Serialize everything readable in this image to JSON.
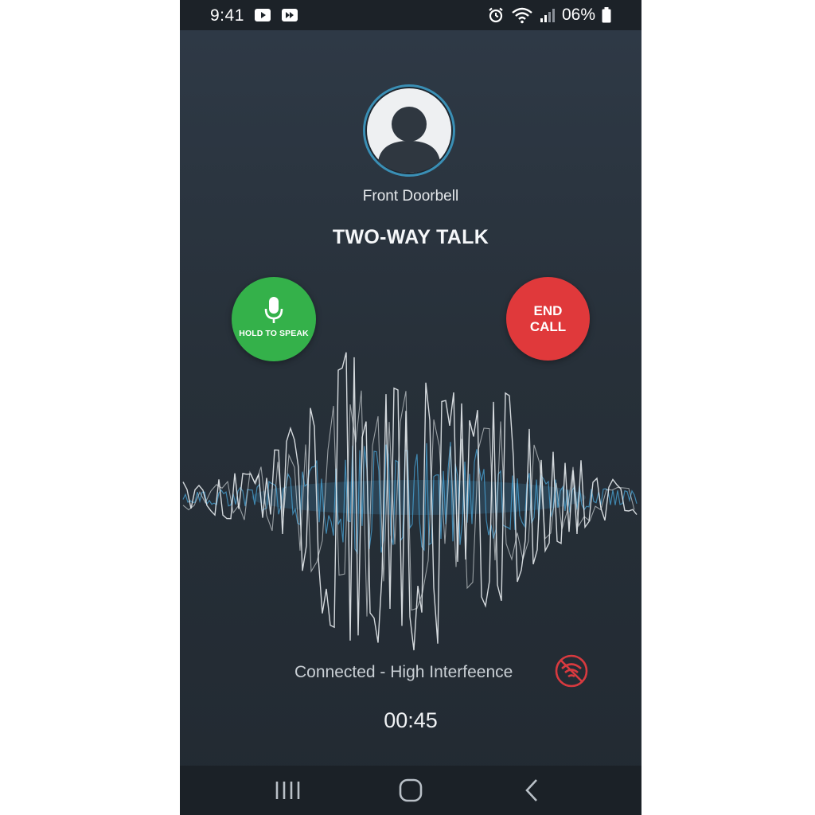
{
  "status_bar": {
    "time": "9:41",
    "battery": "06%",
    "icons": [
      "youtube-icon",
      "media-app-icon",
      "alarm-icon",
      "wifi-icon",
      "signal-icon",
      "battery-icon"
    ]
  },
  "call": {
    "device_name": "Front Doorbell",
    "title": "TWO-WAY TALK",
    "hold_label": "HOLD TO SPEAK",
    "end_label_line1": "END",
    "end_label_line2": "CALL",
    "connection_status": "Connected - High Interfeence",
    "timer": "00:45"
  },
  "colors": {
    "background": "#2a333d",
    "accent_ring": "#3a8fb5",
    "hold_green": "#34b14a",
    "end_red": "#e0393b",
    "interference_red": "#d83a3f",
    "wave_white": "#e8ecef",
    "wave_blue": "#4aa6d8"
  },
  "nav_bar": {
    "icons": [
      "recent-apps-icon",
      "home-icon",
      "back-icon"
    ]
  }
}
